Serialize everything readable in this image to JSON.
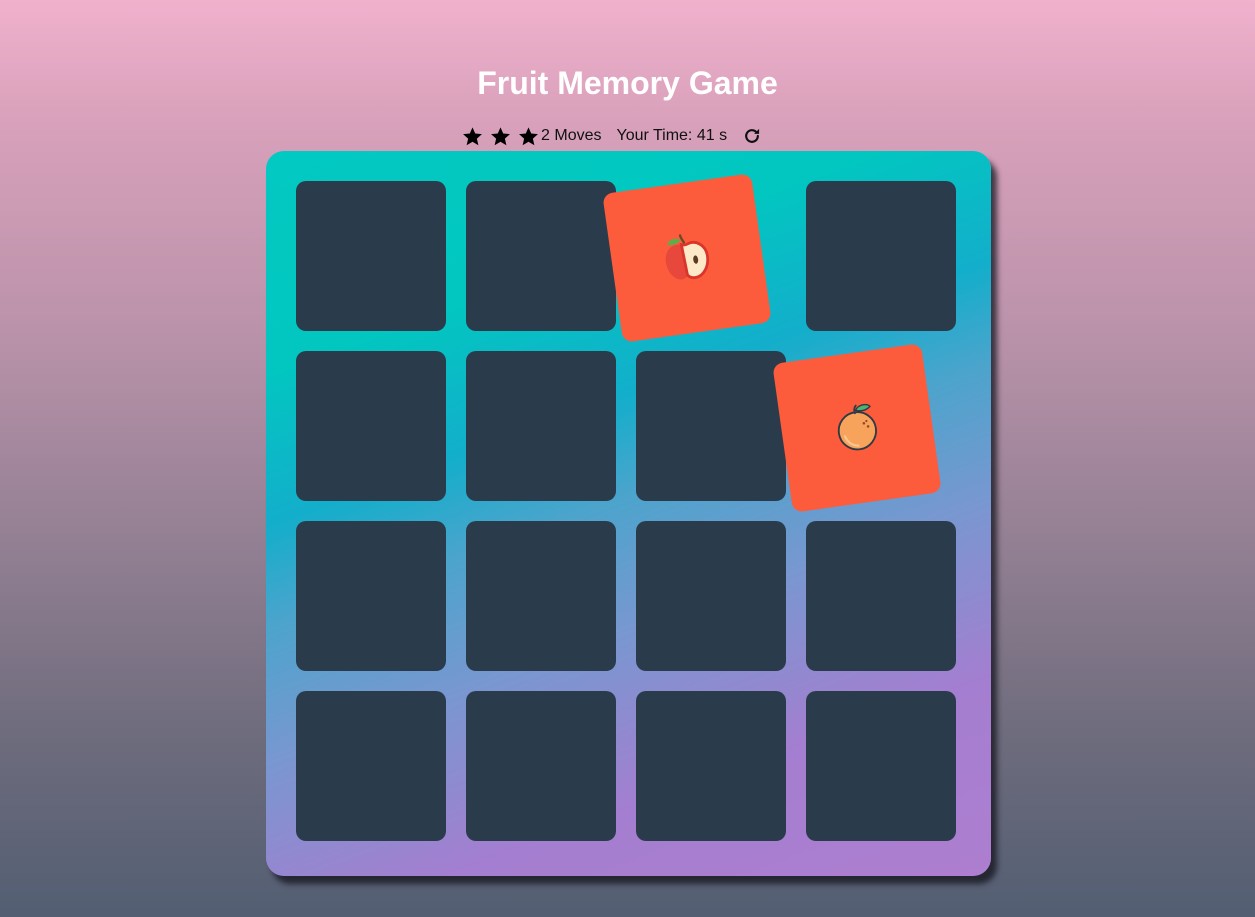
{
  "game": {
    "title": "Fruit Memory Game"
  },
  "score_panel": {
    "stars": 3,
    "moves_count": "2",
    "moves_label": "Moves",
    "time_label": "Your Time:",
    "time_value": "41",
    "time_unit": "s"
  },
  "deck": {
    "rows": 4,
    "columns": 4,
    "cards": [
      {
        "state": "hidden"
      },
      {
        "state": "hidden"
      },
      {
        "state": "open",
        "fruit": "apple-icon"
      },
      {
        "state": "hidden"
      },
      {
        "state": "hidden"
      },
      {
        "state": "hidden"
      },
      {
        "state": "hidden"
      },
      {
        "state": "open",
        "fruit": "orange-icon"
      },
      {
        "state": "hidden"
      },
      {
        "state": "hidden"
      },
      {
        "state": "hidden"
      },
      {
        "state": "hidden"
      },
      {
        "state": "hidden"
      },
      {
        "state": "hidden"
      },
      {
        "state": "hidden"
      },
      {
        "state": "hidden"
      }
    ]
  },
  "colors": {
    "card_back": "#2a3c4b",
    "card_open": "#fc5c3c",
    "deck_gradient_start": "#02c9c1",
    "deck_gradient_end": "#ae7ed0",
    "title": "#ffffff"
  }
}
